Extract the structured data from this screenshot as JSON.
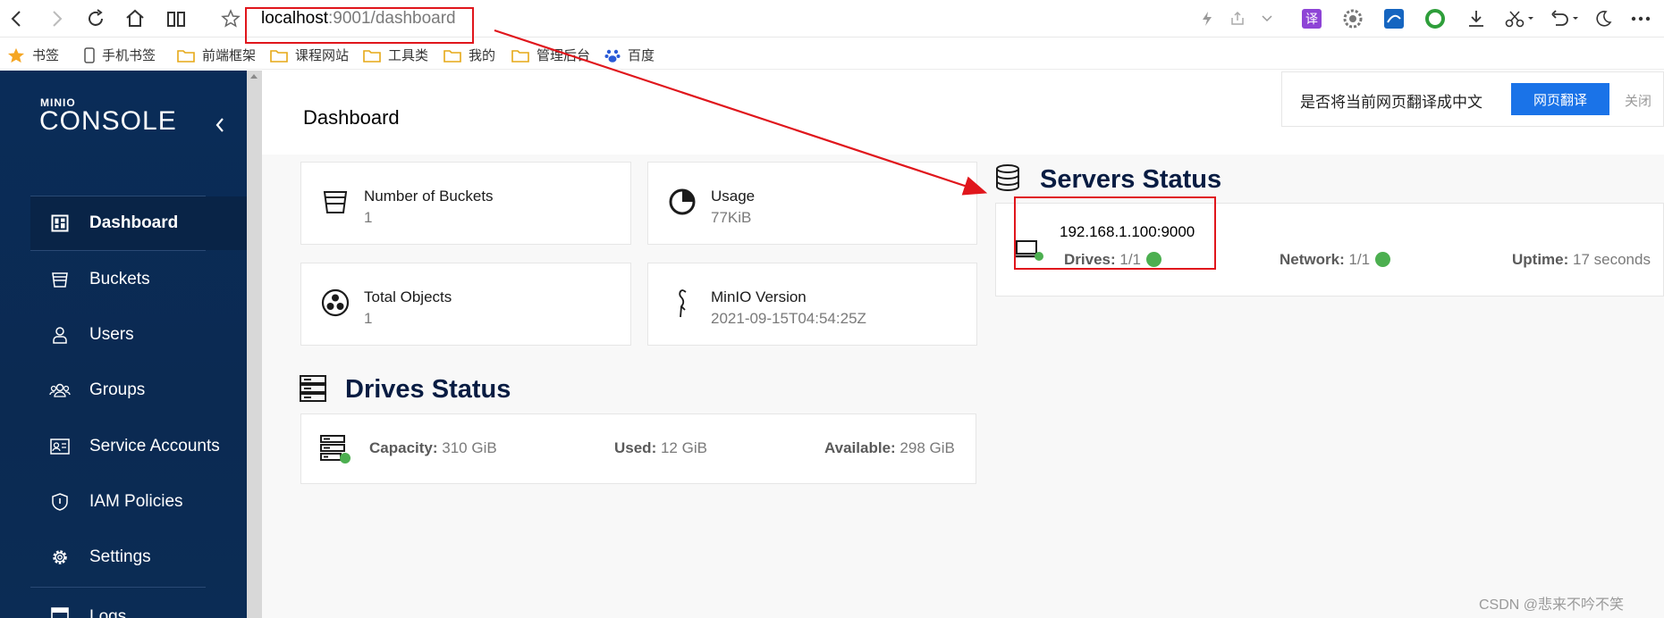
{
  "browser": {
    "url_host": "localhost",
    "url_rest": ":9001/dashboard",
    "bookmarks": [
      {
        "label": "书签",
        "icon": "star-icon"
      },
      {
        "label": "手机书签",
        "icon": "phone-icon"
      },
      {
        "label": "前端框架",
        "icon": "folder-icon"
      },
      {
        "label": "课程网站",
        "icon": "folder-icon"
      },
      {
        "label": "工具类",
        "icon": "folder-icon"
      },
      {
        "label": "我的",
        "icon": "folder-icon"
      },
      {
        "label": "管理后台",
        "icon": "folder-icon"
      },
      {
        "label": "百度",
        "icon": "baidu-paw-icon"
      }
    ],
    "translate_bar": {
      "question": "是否将当前网页翻译成中文",
      "button": "网页翻译",
      "close": "关闭"
    }
  },
  "sidebar": {
    "logo_small": "MINIO",
    "logo_big": "CONSOLE",
    "items": [
      {
        "label": "Dashboard",
        "icon": "dashboard-icon",
        "active": true
      },
      {
        "label": "Buckets",
        "icon": "bucket-icon"
      },
      {
        "label": "Users",
        "icon": "user-icon"
      },
      {
        "label": "Groups",
        "icon": "groups-icon"
      },
      {
        "label": "Service Accounts",
        "icon": "service-accounts-icon"
      },
      {
        "label": "IAM Policies",
        "icon": "shield-icon"
      },
      {
        "label": "Settings",
        "icon": "gear-icon"
      },
      {
        "label": "Logs",
        "icon": "logs-icon"
      }
    ]
  },
  "main": {
    "title": "Dashboard",
    "cards": [
      {
        "label": "Number of Buckets",
        "value": "1",
        "icon": "bucket-icon"
      },
      {
        "label": "Usage",
        "value": "77KiB",
        "icon": "pie-chart-icon"
      },
      {
        "label": "Total Objects",
        "value": "1",
        "icon": "objects-icon"
      },
      {
        "label": "MinIO Version",
        "value": "2021-09-15T04:54:25Z",
        "icon": "flamingo-icon"
      }
    ],
    "drives_status": {
      "title": "Drives Status",
      "capacity_label": "Capacity:",
      "capacity": "310 GiB",
      "used_label": "Used:",
      "used": "12 GiB",
      "available_label": "Available:",
      "available": "298 GiB"
    },
    "servers_status": {
      "title": "Servers Status",
      "server": "192.168.1.100:9000",
      "drives_label": "Drives:",
      "drives": "1/1",
      "network_label": "Network:",
      "network": "1/1",
      "uptime_label": "Uptime:",
      "uptime": "17 seconds"
    }
  },
  "watermark": "CSDN @悲来不吟不笑",
  "colors": {
    "sidebar": "#0b2a52",
    "accent_green": "#4caf50",
    "annotation_red": "#e0161c",
    "translate_blue": "#1a73e8"
  }
}
